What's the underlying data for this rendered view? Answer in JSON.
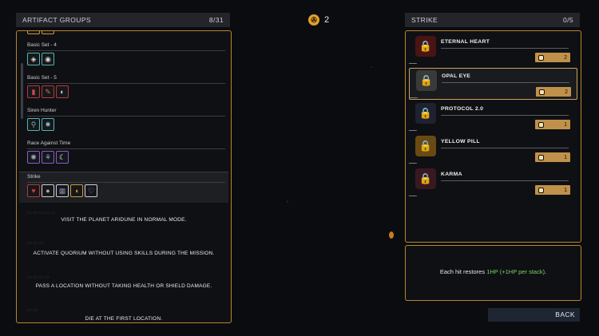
{
  "currency": {
    "icon": "steering-wheel-coin-icon",
    "amount": "2"
  },
  "left": {
    "title": "ARTIFACT GROUPS",
    "count": "8/31",
    "groups": [
      {
        "name": "Basic Set - 4",
        "icons": [
          "teal",
          "teal"
        ]
      },
      {
        "name": "Basic Set - 5",
        "icons": [
          "red",
          "red",
          "red"
        ]
      },
      {
        "name": "Siren Hunter",
        "icons": [
          "teal",
          "teal"
        ]
      },
      {
        "name": "Race Against Time",
        "icons": [
          "purple",
          "purple",
          "purple"
        ]
      },
      {
        "name": "Strike",
        "icons": [
          "red",
          "white",
          "white",
          "gold",
          "white"
        ]
      }
    ],
    "objectives": [
      "VISIT THE PLANET ARIDUNE IN NORMAL MODE.",
      "ACTIVATE QUORIUM WITHOUT USING SKILLS DURING THE MISSION.",
      "PASS A LOCATION WITHOUT TAKING HEALTH OR SHIELD DAMAGE.",
      "DIE AT THE FIRST LOCATION."
    ]
  },
  "right": {
    "title": "STRIKE",
    "count": "0/5",
    "artifacts": [
      {
        "name": "ETERNAL HEART",
        "value": "2",
        "color": "#b83232",
        "icon": "heart-lock-icon"
      },
      {
        "name": "OPAL EYE",
        "value": "2",
        "color": "#7a7a7a",
        "icon": "eye-lock-icon"
      },
      {
        "name": "PROTOCOL 2.0",
        "value": "1",
        "color": "#3a3f55",
        "icon": "protocol-lock-icon"
      },
      {
        "name": "YELLOW PILL",
        "value": "1",
        "color": "#c89a3a",
        "icon": "pill-lock-icon"
      },
      {
        "name": "KARMA",
        "value": "1",
        "color": "#9a2a3a",
        "icon": "karma-lock-icon"
      }
    ],
    "description": {
      "prefix": "Each hit restores ",
      "highlight": "1HP (+1HP per stack)",
      "suffix": "."
    }
  },
  "back_label": "BACK"
}
